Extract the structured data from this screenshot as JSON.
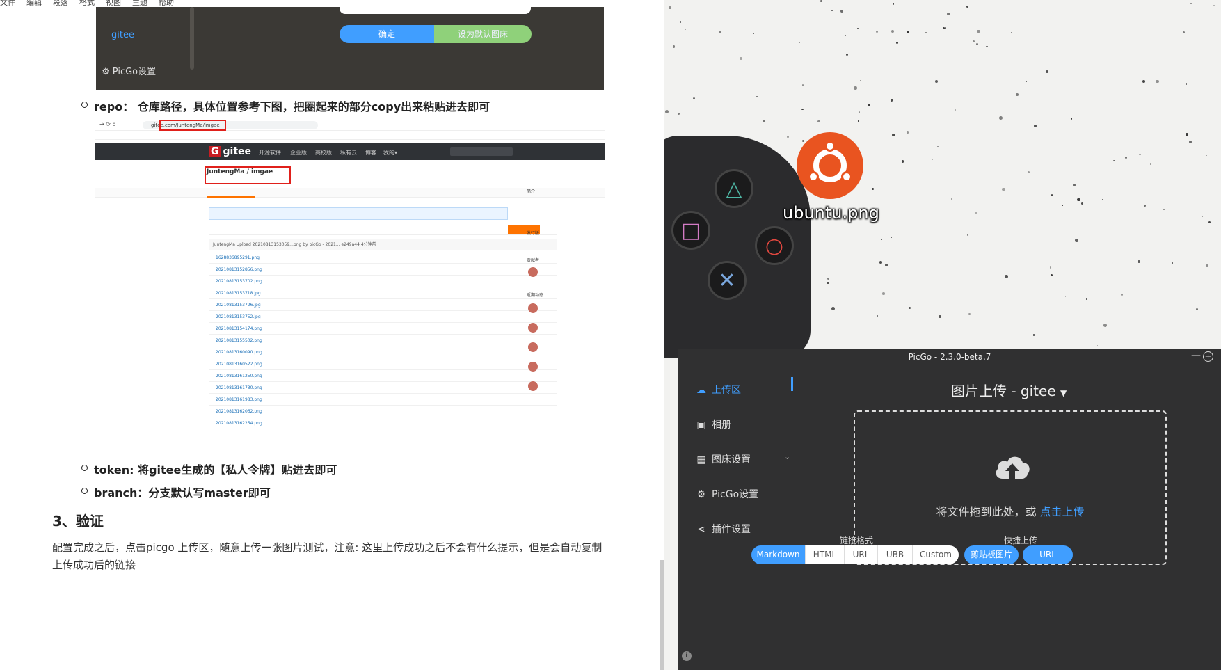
{
  "editor": {
    "menu": [
      "文件",
      "编辑",
      "段落",
      "格式",
      "视图",
      "主题",
      "帮助"
    ],
    "top_shot": {
      "confirm_label": "确定",
      "default_label": "设为默认图床",
      "gitee_label": "gitee",
      "settings_label": "PicGo设置"
    },
    "bullets": {
      "repo": "repo： 仓库路径，具体位置参考下图，把圈起来的部分copy出来粘贴进去即可",
      "token": "token: 将gitee生成的【私人令牌】贴进去即可",
      "branch": "branch：分支默认写master即可"
    },
    "section_title": "3、验证",
    "paragraph": "配置完成之后，点击picgo 上传区，随意上传一张图片测试，注意: 这里上传成功之后不会有什么提示，但是会自动复制上传成功后的链接",
    "gitee_shot": {
      "url": "gitee.com/JuntengMa/imgae",
      "logo": "gitee",
      "nav": [
        "开源软件",
        "企业版",
        "高校版",
        "私有云",
        "博客",
        "我的▾"
      ],
      "repo": "JuntengMa / imgae",
      "commit": "JuntengMa  Upload 20210813153059...png by picGo - 2021... e249a44  4分钟前",
      "files": [
        "1628836895291.png",
        "20210813152856.png",
        "20210813153702.png",
        "20210813153718.jpg",
        "20210813153726.jpg",
        "20210813153752.jpg",
        "20210813154174.png",
        "20210813155502.png",
        "20210813160090.png",
        "20210813160522.png",
        "20210813161250.png",
        "20210813161730.png",
        "20210813161983.png",
        "20210813162062.png",
        "20210813162254.png"
      ],
      "side": [
        "简介",
        "发行版",
        "贡献者",
        "近期动态"
      ]
    }
  },
  "desktop": {
    "file_label": "ubuntu.png"
  },
  "picgo": {
    "title": "PicGo - 2.3.0-beta.7",
    "min_glyph": "—",
    "plus_glyph": "+",
    "nav": [
      {
        "label": "上传区",
        "icon": "cloud-upload-icon",
        "active": true
      },
      {
        "label": "相册",
        "icon": "image-icon",
        "active": false
      },
      {
        "label": "图床设置",
        "icon": "grid-icon",
        "active": false
      },
      {
        "label": "PicGo设置",
        "icon": "gear-icon",
        "active": false
      },
      {
        "label": "插件设置",
        "icon": "share-icon",
        "active": false
      }
    ],
    "header": "图片上传 - gitee",
    "drop_text": "将文件拖到此处，或 ",
    "drop_link": "点击上传",
    "link_format_label": "链接格式",
    "formats": [
      "Markdown",
      "HTML",
      "URL",
      "UBB",
      "Custom"
    ],
    "selected_format": "Markdown",
    "quick_label": "快捷上传",
    "quick_buttons": [
      "剪贴板图片",
      "URL"
    ],
    "accent": "#409eff"
  }
}
